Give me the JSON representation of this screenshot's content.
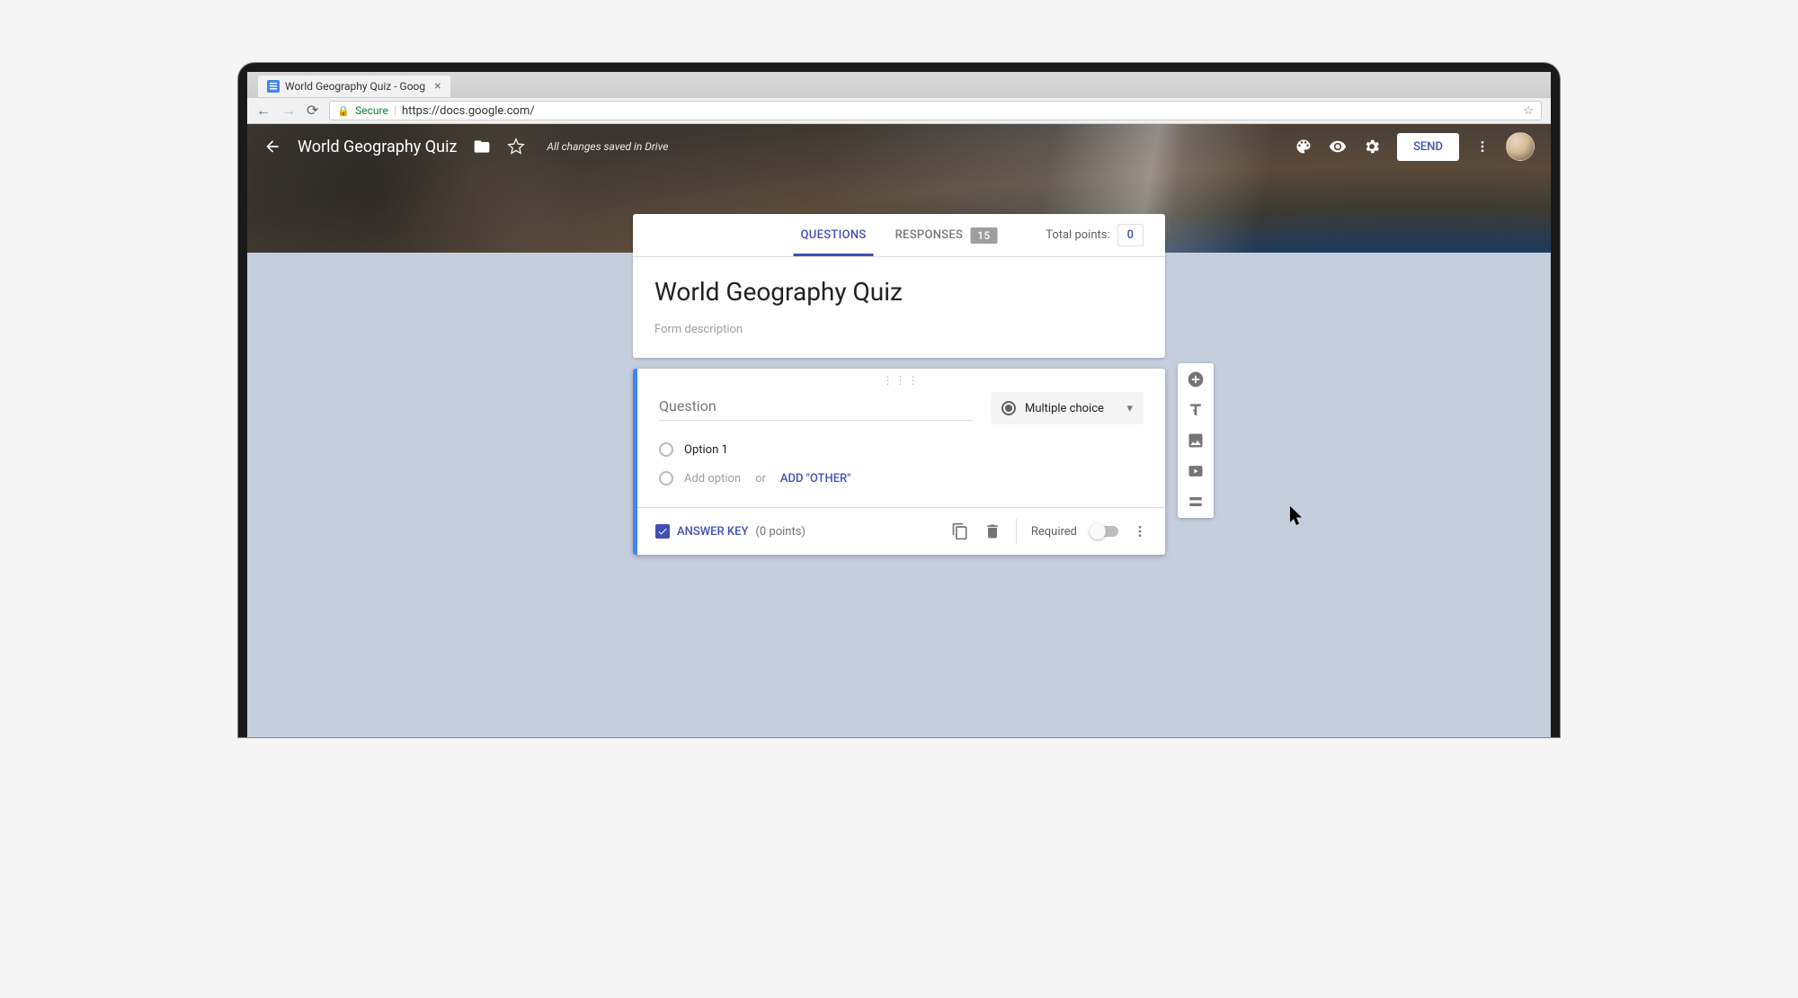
{
  "browser": {
    "tab_title": "World Geography Quiz - Goog",
    "secure_label": "Secure",
    "url_display": "https://docs.google.com/"
  },
  "header": {
    "title": "World Geography Quiz",
    "save_status": "All changes saved in Drive",
    "send_label": "SEND"
  },
  "tabs": {
    "questions": "QUESTIONS",
    "responses": "RESPONSES",
    "responses_count": "15",
    "total_points_label": "Total points:",
    "total_points_value": "0"
  },
  "form": {
    "title": "World Geography Quiz",
    "description_placeholder": "Form description"
  },
  "question": {
    "placeholder": "Question",
    "type_label": "Multiple choice",
    "option1": "Option 1",
    "add_option": "Add option",
    "or_label": "or",
    "add_other": "ADD \"OTHER\"",
    "answer_key": "ANSWER KEY",
    "points_label": "(0 points)",
    "required_label": "Required"
  }
}
